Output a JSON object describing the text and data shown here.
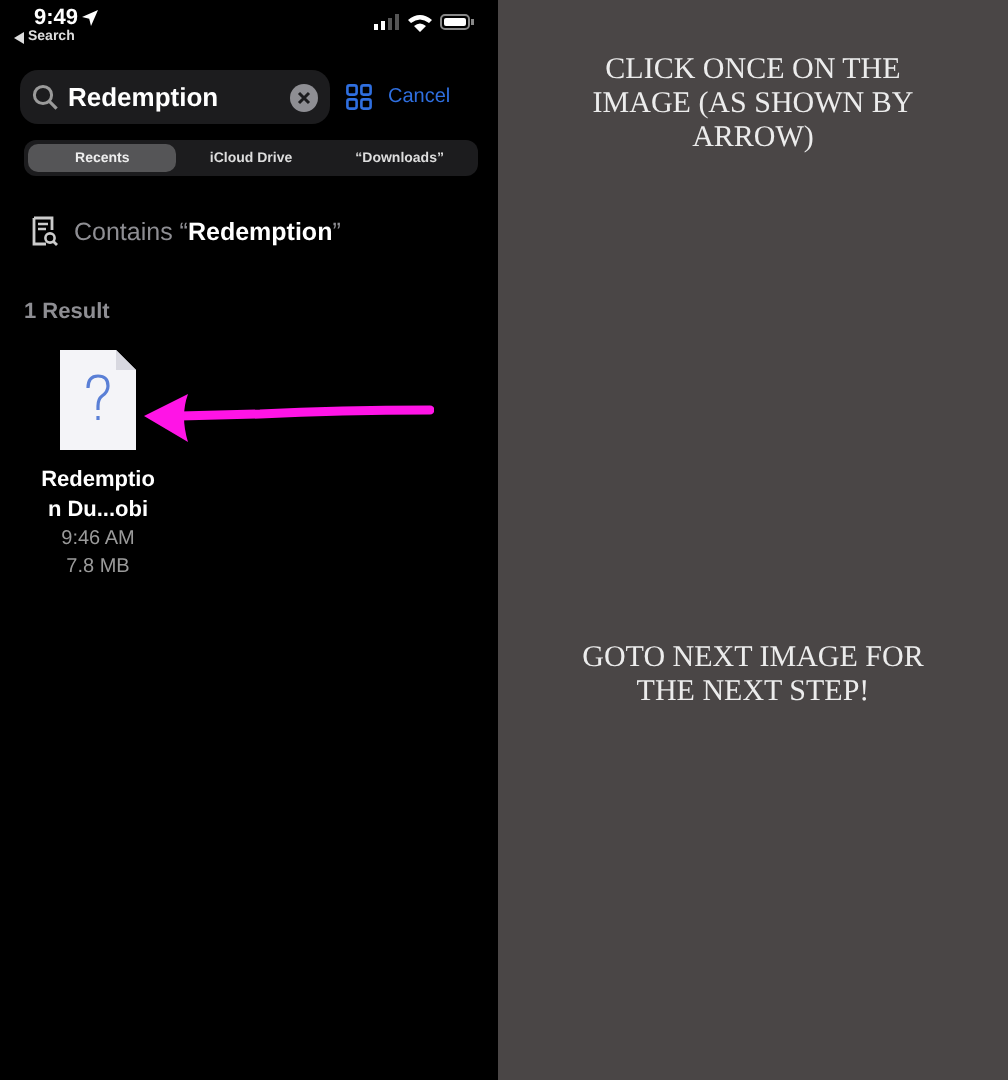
{
  "status_bar": {
    "time": "9:49",
    "back_label": "Search"
  },
  "search": {
    "value": "Redemption",
    "cancel": "Cancel"
  },
  "scopes": [
    {
      "label": "Recents",
      "selected": true
    },
    {
      "label": "iCloud Drive",
      "selected": false
    },
    {
      "label": "“Downloads”",
      "selected": false
    }
  ],
  "suggestion": "Contains “**Redemption**”",
  "result_count": "1 Result",
  "results": [
    {
      "name_lines": [
        "Redemptio",
        "n Du...obi"
      ],
      "time": "9:46 AM",
      "size": "7.8 MB"
    }
  ],
  "instructions": [
    {
      "text": "CLICK ONCE ON THE IMAGE (AS SHOWN BY ARROW)"
    },
    {
      "text": "GOTO NEXT IMAGE FOR THE NEXT STEP!"
    }
  ]
}
